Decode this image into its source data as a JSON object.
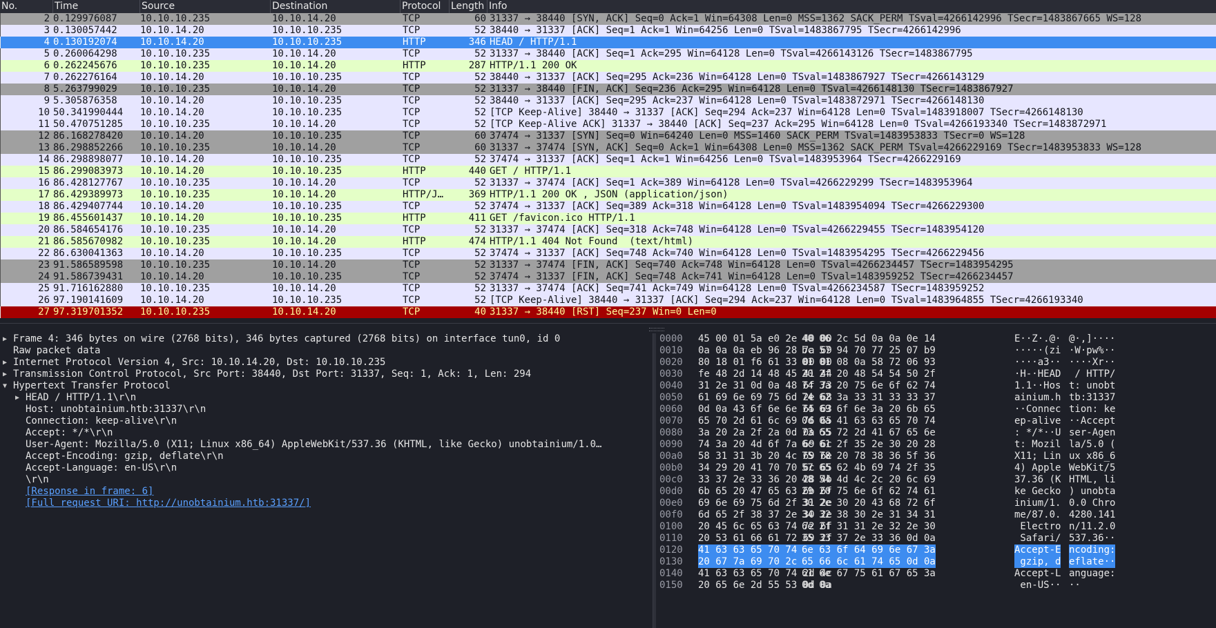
{
  "packet_list": {
    "columns": [
      "No.",
      "Time",
      "Source",
      "Destination",
      "Protocol",
      "Length",
      "Info"
    ],
    "rows": [
      {
        "no": "2",
        "time": "0.129976087",
        "src": "10.10.10.235",
        "dst": "10.10.14.20",
        "proto": "TCP",
        "len": "60",
        "info": "31337 → 38440 [SYN, ACK] Seq=0 Ack=1 Win=64308 Len=0 MSS=1362 SACK_PERM TSval=4266142996 TSecr=1483867665 WS=128",
        "color": "gray"
      },
      {
        "no": "3",
        "time": "0.130057442",
        "src": "10.10.14.20",
        "dst": "10.10.10.235",
        "proto": "TCP",
        "len": "52",
        "info": "38440 → 31337 [ACK] Seq=1 Ack=1 Win=64256 Len=0 TSval=1483867795 TSecr=4266142996",
        "color": "lav"
      },
      {
        "no": "4",
        "time": "0.130192074",
        "src": "10.10.14.20",
        "dst": "10.10.10.235",
        "proto": "HTTP",
        "len": "346",
        "info": "HEAD / HTTP/1.1",
        "color": "sel"
      },
      {
        "no": "5",
        "time": "0.260064298",
        "src": "10.10.10.235",
        "dst": "10.10.14.20",
        "proto": "TCP",
        "len": "52",
        "info": "31337 → 38440 [ACK] Seq=1 Ack=295 Win=64128 Len=0 TSval=4266143126 TSecr=1483867795",
        "color": "lav"
      },
      {
        "no": "6",
        "time": "0.262245676",
        "src": "10.10.10.235",
        "dst": "10.10.14.20",
        "proto": "HTTP",
        "len": "287",
        "info": "HTTP/1.1 200 OK",
        "color": "green"
      },
      {
        "no": "7",
        "time": "0.262276164",
        "src": "10.10.14.20",
        "dst": "10.10.10.235",
        "proto": "TCP",
        "len": "52",
        "info": "38440 → 31337 [ACK] Seq=295 Ack=236 Win=64128 Len=0 TSval=1483867927 TSecr=4266143129",
        "color": "lav"
      },
      {
        "no": "8",
        "time": "5.263799029",
        "src": "10.10.10.235",
        "dst": "10.10.14.20",
        "proto": "TCP",
        "len": "52",
        "info": "31337 → 38440 [FIN, ACK] Seq=236 Ack=295 Win=64128 Len=0 TSval=4266148130 TSecr=1483867927",
        "color": "gray"
      },
      {
        "no": "9",
        "time": "5.305876358",
        "src": "10.10.14.20",
        "dst": "10.10.10.235",
        "proto": "TCP",
        "len": "52",
        "info": "38440 → 31337 [ACK] Seq=295 Ack=237 Win=64128 Len=0 TSval=1483872971 TSecr=4266148130",
        "color": "lav"
      },
      {
        "no": "10",
        "time": "50.341990444",
        "src": "10.10.14.20",
        "dst": "10.10.10.235",
        "proto": "TCP",
        "len": "52",
        "info": "[TCP Keep-Alive] 38440 → 31337 [ACK] Seq=294 Ack=237 Win=64128 Len=0 TSval=1483918007 TSecr=4266148130",
        "color": "lav"
      },
      {
        "no": "11",
        "time": "50.470751285",
        "src": "10.10.10.235",
        "dst": "10.10.14.20",
        "proto": "TCP",
        "len": "52",
        "info": "[TCP Keep-Alive ACK] 31337 → 38440 [ACK] Seq=237 Ack=295 Win=64128 Len=0 TSval=4266193340 TSecr=1483872971",
        "color": "lav"
      },
      {
        "no": "12",
        "time": "86.168278420",
        "src": "10.10.14.20",
        "dst": "10.10.10.235",
        "proto": "TCP",
        "len": "60",
        "info": "37474 → 31337 [SYN] Seq=0 Win=64240 Len=0 MSS=1460 SACK_PERM TSval=1483953833 TSecr=0 WS=128",
        "color": "gray"
      },
      {
        "no": "13",
        "time": "86.298852266",
        "src": "10.10.10.235",
        "dst": "10.10.14.20",
        "proto": "TCP",
        "len": "60",
        "info": "31337 → 37474 [SYN, ACK] Seq=0 Ack=1 Win=64308 Len=0 MSS=1362 SACK_PERM TSval=4266229169 TSecr=1483953833 WS=128",
        "color": "gray"
      },
      {
        "no": "14",
        "time": "86.298898077",
        "src": "10.10.14.20",
        "dst": "10.10.10.235",
        "proto": "TCP",
        "len": "52",
        "info": "37474 → 31337 [ACK] Seq=1 Ack=1 Win=64256 Len=0 TSval=1483953964 TSecr=4266229169",
        "color": "lav"
      },
      {
        "no": "15",
        "time": "86.299083973",
        "src": "10.10.14.20",
        "dst": "10.10.10.235",
        "proto": "HTTP",
        "len": "440",
        "info": "GET / HTTP/1.1",
        "color": "green"
      },
      {
        "no": "16",
        "time": "86.428127767",
        "src": "10.10.10.235",
        "dst": "10.10.14.20",
        "proto": "TCP",
        "len": "52",
        "info": "31337 → 37474 [ACK] Seq=1 Ack=389 Win=64128 Len=0 TSval=4266229299 TSecr=1483953964",
        "color": "lav"
      },
      {
        "no": "17",
        "time": "86.429389973",
        "src": "10.10.10.235",
        "dst": "10.10.14.20",
        "proto": "HTTP/J…",
        "len": "369",
        "info": "HTTP/1.1 200 OK , JSON (application/json)",
        "color": "green"
      },
      {
        "no": "18",
        "time": "86.429407744",
        "src": "10.10.14.20",
        "dst": "10.10.10.235",
        "proto": "TCP",
        "len": "52",
        "info": "37474 → 31337 [ACK] Seq=389 Ack=318 Win=64128 Len=0 TSval=1483954094 TSecr=4266229300",
        "color": "lav"
      },
      {
        "no": "19",
        "time": "86.455601437",
        "src": "10.10.14.20",
        "dst": "10.10.10.235",
        "proto": "HTTP",
        "len": "411",
        "info": "GET /favicon.ico HTTP/1.1",
        "color": "green"
      },
      {
        "no": "20",
        "time": "86.584654176",
        "src": "10.10.10.235",
        "dst": "10.10.14.20",
        "proto": "TCP",
        "len": "52",
        "info": "31337 → 37474 [ACK] Seq=318 Ack=748 Win=64128 Len=0 TSval=4266229455 TSecr=1483954120",
        "color": "lav"
      },
      {
        "no": "21",
        "time": "86.585670982",
        "src": "10.10.10.235",
        "dst": "10.10.14.20",
        "proto": "HTTP",
        "len": "474",
        "info": "HTTP/1.1 404 Not Found  (text/html)",
        "color": "green"
      },
      {
        "no": "22",
        "time": "86.630041363",
        "src": "10.10.14.20",
        "dst": "10.10.10.235",
        "proto": "TCP",
        "len": "52",
        "info": "37474 → 31337 [ACK] Seq=748 Ack=740 Win=64128 Len=0 TSval=1483954295 TSecr=4266229456",
        "color": "lav"
      },
      {
        "no": "23",
        "time": "91.586589598",
        "src": "10.10.10.235",
        "dst": "10.10.14.20",
        "proto": "TCP",
        "len": "52",
        "info": "31337 → 37474 [FIN, ACK] Seq=740 Ack=748 Win=64128 Len=0 TSval=4266234457 TSecr=1483954295",
        "color": "gray"
      },
      {
        "no": "24",
        "time": "91.586739431",
        "src": "10.10.14.20",
        "dst": "10.10.10.235",
        "proto": "TCP",
        "len": "52",
        "info": "37474 → 31337 [FIN, ACK] Seq=748 Ack=741 Win=64128 Len=0 TSval=1483959252 TSecr=4266234457",
        "color": "gray"
      },
      {
        "no": "25",
        "time": "91.716162880",
        "src": "10.10.10.235",
        "dst": "10.10.14.20",
        "proto": "TCP",
        "len": "52",
        "info": "31337 → 37474 [ACK] Seq=741 Ack=749 Win=64128 Len=0 TSval=4266234587 TSecr=1483959252",
        "color": "lav"
      },
      {
        "no": "26",
        "time": "97.190141609",
        "src": "10.10.14.20",
        "dst": "10.10.10.235",
        "proto": "TCP",
        "len": "52",
        "info": "[TCP Keep-Alive] 38440 → 31337 [ACK] Seq=294 Ack=237 Win=64128 Len=0 TSval=1483964855 TSecr=4266193340",
        "color": "lav"
      },
      {
        "no": "27",
        "time": "97.319701352",
        "src": "10.10.10.235",
        "dst": "10.10.14.20",
        "proto": "TCP",
        "len": "40",
        "info": "31337 → 38440 [RST] Seq=237 Win=0 Len=0",
        "color": "red"
      }
    ]
  },
  "details": {
    "lines": [
      {
        "arrow": "collapsed",
        "indent": 0,
        "text": "Frame 4: 346 bytes on wire (2768 bits), 346 bytes captured (2768 bits) on interface tun0, id 0",
        "link": false
      },
      {
        "arrow": "none",
        "indent": 0,
        "text": "Raw packet data",
        "link": false
      },
      {
        "arrow": "collapsed",
        "indent": 0,
        "text": "Internet Protocol Version 4, Src: 10.10.14.20, Dst: 10.10.10.235",
        "link": false
      },
      {
        "arrow": "collapsed",
        "indent": 0,
        "text": "Transmission Control Protocol, Src Port: 38440, Dst Port: 31337, Seq: 1, Ack: 1, Len: 294",
        "link": false
      },
      {
        "arrow": "expanded",
        "indent": 0,
        "text": "Hypertext Transfer Protocol",
        "link": false
      },
      {
        "arrow": "collapsed",
        "indent": 1,
        "text": "HEAD / HTTP/1.1\\r\\n",
        "link": false
      },
      {
        "arrow": "none",
        "indent": 1,
        "text": "Host: unobtainium.htb:31337\\r\\n",
        "link": false
      },
      {
        "arrow": "none",
        "indent": 1,
        "text": "Connection: keep-alive\\r\\n",
        "link": false
      },
      {
        "arrow": "none",
        "indent": 1,
        "text": "Accept: */*\\r\\n",
        "link": false
      },
      {
        "arrow": "none",
        "indent": 1,
        "text": "User-Agent: Mozilla/5.0 (X11; Linux x86_64) AppleWebKit/537.36 (KHTML, like Gecko) unobtainium/1.0…",
        "link": false
      },
      {
        "arrow": "none",
        "indent": 1,
        "text": "Accept-Encoding: gzip, deflate\\r\\n",
        "link": false
      },
      {
        "arrow": "none",
        "indent": 1,
        "text": "Accept-Language: en-US\\r\\n",
        "link": false
      },
      {
        "arrow": "none",
        "indent": 1,
        "text": "\\r\\n",
        "link": false
      },
      {
        "arrow": "none",
        "indent": 1,
        "text": "[Response in frame: 6]",
        "link": true
      },
      {
        "arrow": "none",
        "indent": 1,
        "text": "[Full request URI: http://unobtainium.htb:31337/]",
        "link": true
      }
    ]
  },
  "bytes": {
    "rows": [
      {
        "off": "0000",
        "hex1": "45 00 01 5a e0 2e 40 00",
        "hex2": "40 06 2c 5d 0a 0a 0e 14",
        "asc1": "E··Z·.@·",
        "asc2": "@·,]····",
        "hl": false
      },
      {
        "off": "0010",
        "hex1": "0a 0a 0a eb 96 28 7a 69",
        "hex2": "bc 57 94 70 77 25 07 b9",
        "asc1": "·····(zi",
        "asc2": "·W·pw%··",
        "hl": false
      },
      {
        "off": "0020",
        "hex1": "80 18 01 f6 61 33 00 00",
        "hex2": "01 01 08 0a 58 72 06 93",
        "asc1": "····a3··",
        "asc2": "····Xr··",
        "hl": false
      },
      {
        "off": "0030",
        "hex1": "fe 48 2d 14 48 45 41 44",
        "hex2": "20 2f 20 48 54 54 50 2f",
        "asc1": "·H-·HEAD",
        "asc2": " / HTTP/",
        "hl": false
      },
      {
        "off": "0040",
        "hex1": "31 2e 31 0d 0a 48 6f 73",
        "hex2": "74 3a 20 75 6e 6f 62 74",
        "asc1": "1.1··Hos",
        "asc2": "t: unobt",
        "hl": false
      },
      {
        "off": "0050",
        "hex1": "61 69 6e 69 75 6d 2e 68",
        "hex2": "74 62 3a 33 31 33 33 37",
        "asc1": "ainium.h",
        "asc2": "tb:31337",
        "hl": false
      },
      {
        "off": "0060",
        "hex1": "0d 0a 43 6f 6e 6e 65 63",
        "hex2": "74 69 6f 6e 3a 20 6b 65",
        "asc1": "··Connec",
        "asc2": "tion: ke",
        "hl": false
      },
      {
        "off": "0070",
        "hex1": "65 70 2d 61 6c 69 76 65",
        "hex2": "0d 0a 41 63 63 65 70 74",
        "asc1": "ep-alive",
        "asc2": "··Accept",
        "hl": false
      },
      {
        "off": "0080",
        "hex1": "3a 20 2a 2f 2a 0d 0a 55",
        "hex2": "73 65 72 2d 41 67 65 6e",
        "asc1": ": */*··U",
        "asc2": "ser-Agen",
        "hl": false
      },
      {
        "off": "0090",
        "hex1": "74 3a 20 4d 6f 7a 69 6c",
        "hex2": "6c 61 2f 35 2e 30 20 28",
        "asc1": "t: Mozil",
        "asc2": "la/5.0 (",
        "hl": false
      },
      {
        "off": "00a0",
        "hex1": "58 31 31 3b 20 4c 69 6e",
        "hex2": "75 78 20 78 38 36 5f 36",
        "asc1": "X11; Lin",
        "asc2": "ux x86_6",
        "hl": false
      },
      {
        "off": "00b0",
        "hex1": "34 29 20 41 70 70 6c 65",
        "hex2": "57 65 62 4b 69 74 2f 35",
        "asc1": "4) Apple",
        "asc2": "WebKit/5",
        "hl": false
      },
      {
        "off": "00c0",
        "hex1": "33 37 2e 33 36 20 28 4b",
        "hex2": "48 54 4d 4c 2c 20 6c 69",
        "asc1": "37.36 (K",
        "asc2": "HTML, li",
        "hl": false
      },
      {
        "off": "00d0",
        "hex1": "6b 65 20 47 65 63 6b 6f",
        "hex2": "29 20 75 6e 6f 62 74 61",
        "asc1": "ke Gecko",
        "asc2": ") unobta",
        "hl": false
      },
      {
        "off": "00e0",
        "hex1": "69 6e 69 75 6d 2f 31 2e",
        "hex2": "30 2e 30 20 43 68 72 6f",
        "asc1": "inium/1.",
        "asc2": "0.0 Chro",
        "hl": false
      },
      {
        "off": "00f0",
        "hex1": "6d 65 2f 38 37 2e 30 2e",
        "hex2": "34 32 38 30 2e 31 34 31",
        "asc1": "me/87.0.",
        "asc2": "4280.141",
        "hl": false
      },
      {
        "off": "0100",
        "hex1": "20 45 6c 65 63 74 72 6f",
        "hex2": "6e 2f 31 31 2e 32 2e 30",
        "asc1": " Electro",
        "asc2": "n/11.2.0",
        "hl": false
      },
      {
        "off": "0110",
        "hex1": "20 53 61 66 61 72 69 2f",
        "hex2": "35 33 37 2e 33 36 0d 0a",
        "asc1": " Safari/",
        "asc2": "537.36··",
        "hl": false
      },
      {
        "off": "0120",
        "hex1": "41 63 63 65 70 74 2d 45",
        "hex2": "6e 63 6f 64 69 6e 67 3a",
        "asc1": "Accept-E",
        "asc2": "ncoding:",
        "hl": true
      },
      {
        "off": "0130",
        "hex1": "20 67 7a 69 70 2c 20 64",
        "hex2": "65 66 6c 61 74 65 0d 0a",
        "asc1": " gzip, d",
        "asc2": "eflate··",
        "hl": true
      },
      {
        "off": "0140",
        "hex1": "41 63 63 65 70 74 2d 4c",
        "hex2": "61 6e 67 75 61 67 65 3a",
        "asc1": "Accept-L",
        "asc2": "anguage:",
        "hl": false
      },
      {
        "off": "0150",
        "hex1": "20 65 6e 2d 55 53 0d 0a",
        "hex2": "0d 0a",
        "asc1": " en-US··",
        "asc2": "··",
        "hl": false
      }
    ]
  },
  "colors": {
    "gray": "#a0a0a0",
    "lavender": "#e7e6ff",
    "green": "#e4ffc7",
    "selected": "#3d8cf0",
    "red": "#a40000",
    "background": "#1e2028"
  }
}
